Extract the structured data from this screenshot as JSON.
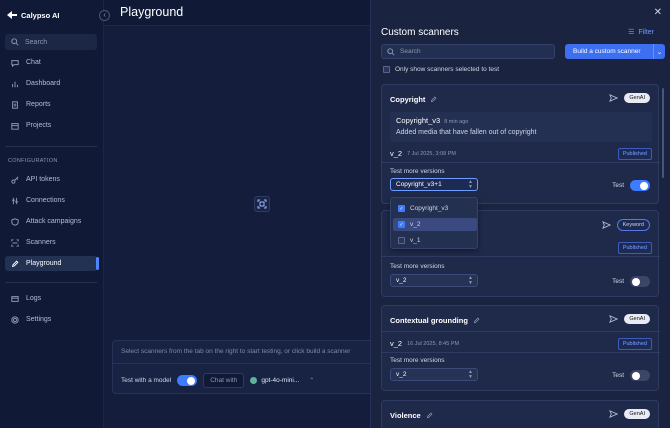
{
  "sidebar": {
    "logo": "Calypso AI",
    "search_label": "Search",
    "items": [
      {
        "label": "Chat"
      },
      {
        "label": "Dashboard"
      },
      {
        "label": "Reports"
      },
      {
        "label": "Projects"
      }
    ],
    "section_label": "CONFIGURATION",
    "config_items": [
      {
        "label": "API tokens"
      },
      {
        "label": "Connections"
      },
      {
        "label": "Attack campaigns"
      },
      {
        "label": "Scanners"
      },
      {
        "label": "Playground"
      }
    ],
    "bottom_items": [
      {
        "label": "Logs"
      },
      {
        "label": "Settings"
      }
    ],
    "active_item": "Playground"
  },
  "main": {
    "title": "Playground",
    "chat_hint": "Select scanners from the tab on the right to start testing, or click build a scanner",
    "test_with_model_label": "Test with a model",
    "test_with_model_on": true,
    "chat_with_label": "Chat with",
    "model_name": "gpt-4o-mini..."
  },
  "panel": {
    "title": "Custom scanners",
    "filter_label": "Filter",
    "search_placeholder": "Search",
    "build_label": "Build a custom scanner",
    "only_show_label": "Only show scanners selected to test",
    "test_label": "Test",
    "test_more_label": "Test more versions",
    "published_label": "Published",
    "cards": [
      {
        "name": "Copyright",
        "badge": "GenAI",
        "latest_version": "Copyright_v3",
        "latest_time": "8 min ago",
        "latest_desc": "Added media that have fallen out of copyright",
        "published_version": "v_2",
        "published_date": "7 Jul 2025, 3:08 PM",
        "select_value": "Copyright_v3+1",
        "test_on": true
      },
      {
        "name": "",
        "badge": "Keyword",
        "select_value": "v_2",
        "test_on": false
      },
      {
        "name": "Contextual grounding",
        "badge": "GenAI",
        "published_version": "v_2",
        "published_date": "16 Jul 2025, 8:45 PM",
        "select_value": "v_2",
        "test_on": false
      },
      {
        "name": "Violence",
        "badge": "GenAI"
      }
    ],
    "dropdown_options": [
      {
        "label": "Copyright_v3",
        "checked": true
      },
      {
        "label": "v_2",
        "checked": true
      },
      {
        "label": "v_1",
        "checked": false
      }
    ]
  }
}
